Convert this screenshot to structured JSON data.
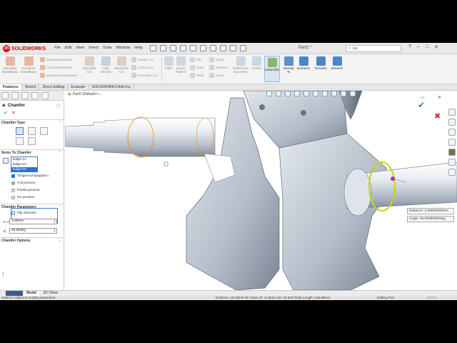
{
  "app": {
    "logo_text": "SOLIDWORKS",
    "brand_color": "#d40000",
    "document_title": "Part2 *"
  },
  "menu": [
    "File",
    "Edit",
    "View",
    "Insert",
    "Tools",
    "Window",
    "Help"
  ],
  "search": {
    "value": "lay"
  },
  "ribbon": {
    "buttons": [
      {
        "label": "Extruded Boss/Base",
        "icon": "extrude-icon"
      },
      {
        "label": "Revolved Boss/Base",
        "icon": "revolve-icon"
      },
      {
        "label": "Swept Boss/Base",
        "icon": "sweep-icon"
      },
      {
        "label": "Lofted Boss/Base",
        "icon": "loft-icon"
      },
      {
        "label": "Boundary Boss/Base",
        "icon": "boundary-icon"
      },
      {
        "label": "Extruded Cut",
        "icon": "extruded-cut-icon"
      },
      {
        "label": "Hole Wizard",
        "icon": "hole-wizard-icon"
      },
      {
        "label": "Revolved Cut",
        "icon": "revolved-cut-icon"
      },
      {
        "label": "Swept Cut",
        "icon": "swept-cut-icon"
      },
      {
        "label": "Lofted Cut",
        "icon": "lofted-cut-icon"
      },
      {
        "label": "Boundary Cut",
        "icon": "boundary-cut-icon"
      },
      {
        "label": "Fillet",
        "icon": "fillet-icon"
      },
      {
        "label": "Linear Pattern",
        "icon": "linear-pattern-icon"
      },
      {
        "label": "Rib",
        "icon": "rib-icon"
      },
      {
        "label": "Draft",
        "icon": "draft-icon"
      },
      {
        "label": "Shell",
        "icon": "shell-icon"
      },
      {
        "label": "Wrap",
        "icon": "wrap-icon"
      },
      {
        "label": "Intersect",
        "icon": "intersect-icon"
      },
      {
        "label": "Mirror",
        "icon": "mirror-icon"
      },
      {
        "label": "Reference Geometry",
        "icon": "reference-geometry-icon"
      },
      {
        "label": "Curves",
        "icon": "curves-icon"
      },
      {
        "label": "Instant3D",
        "icon": "instant3d-icon"
      },
      {
        "label": "Normal To",
        "icon": "normal-to-icon"
      },
      {
        "label": "Isometric",
        "icon": "isometric-icon"
      },
      {
        "label": "Trimetric",
        "icon": "trimetric-icon"
      },
      {
        "label": "Dimetric",
        "icon": "dimetric-icon"
      }
    ]
  },
  "tabs": [
    "Features",
    "Sketch",
    "Direct Editing",
    "Evaluate",
    "SOLIDWORKS Add-Ins"
  ],
  "panel": {
    "title": "Chamfer",
    "ok_icon": "check-icon",
    "cancel_icon": "close-icon",
    "sections": {
      "type": "Chamfer Type",
      "items": "Items To Chamfer",
      "params": "Chamfer Parameters",
      "options": "Chamfer Options"
    },
    "edges": [
      "Edge<1>",
      "Edge<2>",
      "Edge<3>"
    ],
    "selected_edge_index": 2,
    "tangent_propagation": "Tangent propagation",
    "preview_options": [
      "Full preview",
      "Partial preview",
      "No preview"
    ],
    "preview_selected": 0,
    "flip_direction": "Flip direction",
    "distance": "1.00mm",
    "angle": "45.00deg"
  },
  "viewport": {
    "breadcrumb": "Part2  (Default<<...",
    "callout": {
      "distance_label": "Distance:",
      "distance_value": "1.00000000mm",
      "angle_label": "Angle:",
      "angle_value": "45.00000000deg"
    },
    "accent_color": "#c6d800",
    "feature_preview_color": "#f08c00"
  },
  "bottom_tabs": [
    "Model",
    "3D Views"
  ],
  "status": {
    "left": "Select a callout to modify parameters",
    "measure": "Distance: 19.16mm    dX: 5mm    dY: 0.16mm    dZ: 18.5mmTotal Length: 125.66mm",
    "mode": "Editing Part",
    "units": "MMGS"
  }
}
